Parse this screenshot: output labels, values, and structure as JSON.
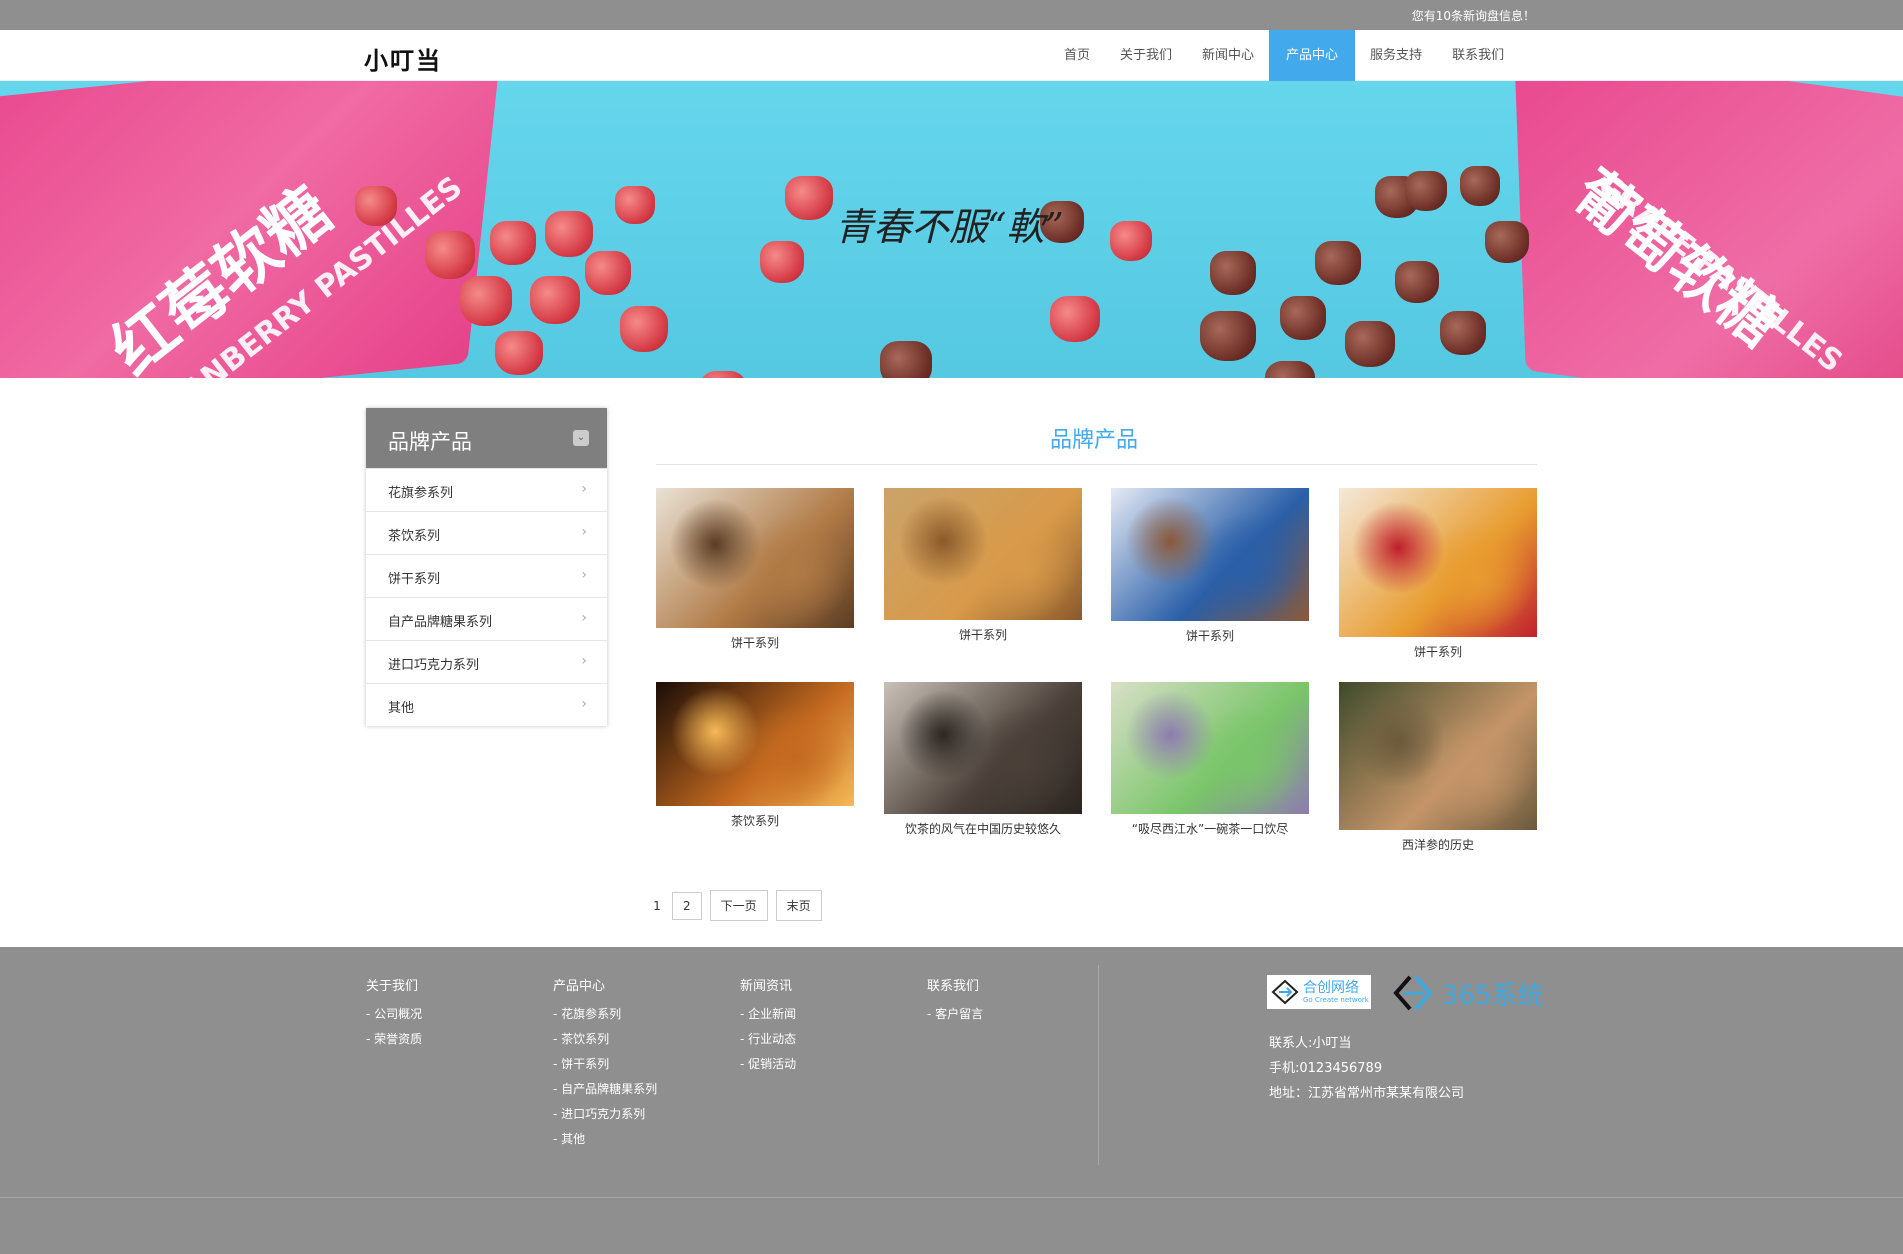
{
  "topbar": {
    "notice": "您有10条新询盘信息！"
  },
  "header": {
    "logo": "小叮当",
    "nav": [
      {
        "label": "首页",
        "active": false
      },
      {
        "label": "关于我们",
        "active": false
      },
      {
        "label": "新闻中心",
        "active": false
      },
      {
        "label": "产品中心",
        "active": true
      },
      {
        "label": "服务支持",
        "active": false
      },
      {
        "label": "联系我们",
        "active": false
      }
    ]
  },
  "banner": {
    "slogan": "青春不服“軟”",
    "left_pack_text": "红莓软糖",
    "left_pack_sub": "CRANBERRY PASTILLES",
    "right_pack_text": "葡萄软糖",
    "right_pack_sub": "GRAPE PASTILLES"
  },
  "sidebar": {
    "title": "品牌产品",
    "items": [
      "花旗参系列",
      "茶饮系列",
      "饼干系列",
      "自产品牌糖果系列",
      "进口巧克力系列",
      "其他"
    ]
  },
  "content": {
    "title": "品牌产品",
    "products": [
      {
        "caption": "饼干系列",
        "palette": [
          "#e9e2d6",
          "#b07a45",
          "#5b3c24"
        ]
      },
      {
        "caption": "饼干系列",
        "palette": [
          "#caa36a",
          "#d89a4a",
          "#8b5a2b"
        ]
      },
      {
        "caption": "饼干系列",
        "palette": [
          "#e5eaf5",
          "#2a5fa8",
          "#8a5a3a"
        ]
      },
      {
        "caption": "饼干系列",
        "palette": [
          "#f4e9da",
          "#e89c2f",
          "#c01f2d"
        ]
      },
      {
        "caption": "茶饮系列",
        "palette": [
          "#1a0c06",
          "#c46a20",
          "#f5b957"
        ]
      },
      {
        "caption": "饮茶的风气在中国历史较悠久",
        "palette": [
          "#c9c1b8",
          "#4a4039",
          "#2c2621"
        ]
      },
      {
        "caption": "“吸尽西江水”一碗茶一口饮尽",
        "palette": [
          "#d8dfc8",
          "#7ac56a",
          "#8f7bb0"
        ]
      },
      {
        "caption": "西洋参的历史",
        "palette": [
          "#3d4a2c",
          "#c59569",
          "#6b5a3c"
        ]
      }
    ]
  },
  "pager": {
    "current": "1",
    "page2": "2",
    "next": "下一页",
    "last": "末页"
  },
  "footer": {
    "columns": [
      {
        "title": "关于我们",
        "links": [
          "公司概况",
          "荣誉资质"
        ]
      },
      {
        "title": "产品中心",
        "links": [
          "花旗参系列",
          "茶饮系列",
          "饼干系列",
          "自产品牌糖果系列",
          "进口巧克力系列",
          "其他"
        ]
      },
      {
        "title": "新闻资讯",
        "links": [
          "企业新闻",
          "行业动态",
          "促销活动"
        ]
      },
      {
        "title": "联系我们",
        "links": [
          "客户留言"
        ]
      }
    ],
    "logo1_text": "合创网络",
    "logo1_sub": "Go Create network",
    "logo2_text": "365系统",
    "contact_person": "联系人:小叮当",
    "contact_phone": "手机:0123456789",
    "contact_address": "地址：江苏省常州市某某有限公司"
  }
}
